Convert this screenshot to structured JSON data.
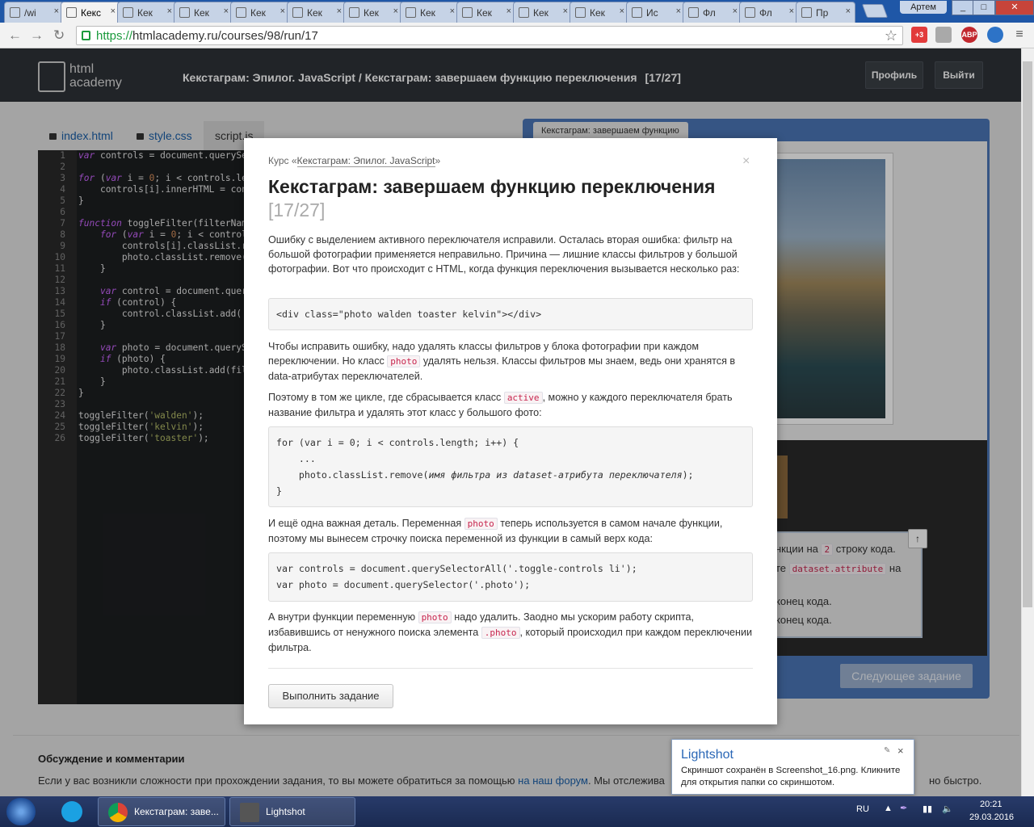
{
  "browser": {
    "tabs": [
      {
        "title": "/wi",
        "icon": "bolt-icon"
      },
      {
        "title": "Кекс",
        "icon": "academy-icon",
        "active": true
      },
      {
        "title": "Кек",
        "icon": "academy-icon"
      },
      {
        "title": "Кек",
        "icon": "academy-icon"
      },
      {
        "title": "Кек",
        "icon": "academy-icon"
      },
      {
        "title": "Кек",
        "icon": "academy-icon"
      },
      {
        "title": "Кек",
        "icon": "academy-icon"
      },
      {
        "title": "Кек",
        "icon": "academy-icon"
      },
      {
        "title": "Кек",
        "icon": "academy-icon"
      },
      {
        "title": "Кек",
        "icon": "academy-icon"
      },
      {
        "title": "Кек",
        "icon": "academy-icon"
      },
      {
        "title": "Ис",
        "icon": "academy-icon"
      },
      {
        "title": "Фл",
        "icon": "academy-icon"
      },
      {
        "title": "Фл",
        "icon": "academy-icon"
      },
      {
        "title": "Пр",
        "icon": "academy-icon"
      }
    ],
    "profile_name": "Артем",
    "url_scheme": "https://",
    "url_rest": "htmlacademy.ru/courses/98/run/17",
    "extension_badge": "+3",
    "abp_label": "ABP"
  },
  "site": {
    "logo_line1": "html",
    "logo_line2": "academy",
    "breadcrumb_course": "Кекстаграм: Эпилог. JavaScript",
    "breadcrumb_sep": " / ",
    "breadcrumb_task": "Кекстаграм: завершаем функцию переключения",
    "breadcrumb_pos": "[17/27]",
    "profile_button": "Профиль",
    "logout_button": "Выйти"
  },
  "editor": {
    "tabs": [
      "index.html",
      "style.css",
      "script.js"
    ],
    "line_numbers": [
      "1",
      "2",
      "3",
      "4",
      "5",
      "6",
      "7",
      "8",
      "9",
      "10",
      "11",
      "12",
      "13",
      "14",
      "15",
      "16",
      "17",
      "18",
      "19",
      "20",
      "21",
      "22",
      "23",
      "24",
      "25",
      "26"
    ],
    "lines": [
      "var controls = document.querySe",
      "",
      "for (var i = 0; i < controls.le",
      "    controls[i].innerHTML = con",
      "}",
      "",
      "function toggleFilter(filterNam",
      "    for (var i = 0; i < control",
      "        controls[i].classList.r",
      "        photo.classList.remove(",
      "    }",
      "",
      "    var control = document.quer",
      "    if (control) {",
      "        control.classList.add('",
      "    }",
      "",
      "    var photo = document.queryS",
      "    if (photo) {",
      "        photo.classList.add(fil",
      "    }",
      "}",
      "",
      "toggleFilter('walden');",
      "toggleFilter('kelvin');",
      "toggleFilter('toaster');"
    ]
  },
  "preview": {
    "tab_title": "Кекстаграм: завершаем функцию",
    "task_line1_pre": "нкции на",
    "task_line1_code": "2",
    "task_line1_post": "строку кода.",
    "task_line2_pre": "те",
    "task_line2_code": "dataset.attribute",
    "task_line2_post": "на",
    "task_line3": "конец кода.",
    "task_line4": "конец кода.",
    "up_button": "↑",
    "next_button": "Следующее задание"
  },
  "discussion": {
    "heading": "Обсуждение и комментарии",
    "text_pre": "Если у вас возникли сложности при прохождении задания, то вы можете обратиться за помощью",
    "link": "на наш форум",
    "text_post": ". Мы отслежива",
    "text_end": "но быстро."
  },
  "modal": {
    "course_prefix": "Курс «",
    "course_link": "Кекстаграм: Эпилог. JavaScript",
    "course_suffix": "»",
    "close": "×",
    "title": "Кекстаграм: завершаем функцию переключения",
    "title_pos": "[17/27]",
    "p1": "Ошибку с выделением активного переключателя исправили. Осталась вторая ошибка: фильтр на большой фотографии применяется неправильно. Причина — лишние классы фильтров у большой фотографии. Вот что происходит с HTML, когда функция переключения вызывается несколько раз:",
    "code1": "<div class=\"photo walden toaster kelvin\"></div>",
    "p2_a": "Чтобы исправить ошибку, надо удалять классы фильтров у блока фотографии при каждом переключении. Но класс",
    "p2_code": "photo",
    "p2_b": "удалять нельзя. Классы фильтров мы знаем, ведь они хранятся в data-атрибутах переключателей.",
    "p3_a": "Поэтому в том же цикле, где сбрасывается класс",
    "p3_code": "active",
    "p3_b": ", можно у каждого переключателя брать название фильтра и удалять этот класс у большого фото:",
    "code2_l1": "for (var i = 0; i < controls.length; i++) {",
    "code2_l2": "    ...",
    "code2_l3a": "    photo.classList.remove(",
    "code2_l3i": "имя фильтра из dataset-атрибута переключателя",
    "code2_l3b": ");",
    "code2_l4": "}",
    "p4_a": "И ещё одна важная деталь. Переменная",
    "p4_code": "photo",
    "p4_b": "теперь используется в самом начале функции, поэтому мы вынесем строчку поиска переменной из функции в самый верх кода:",
    "code3_l1": "var controls = document.querySelectorAll('.toggle-controls li');",
    "code3_l2": "var photo = document.querySelector('.photo');",
    "p5_a": "А внутри функции переменную",
    "p5_code": "photo",
    "p5_b": "надо удалить. Заодно мы ускорим работу скрипта, избавившись от ненужного поиска элемента",
    "p5_code2": ".photo",
    "p5_c": ", который происходил при каждом переключении фильтра.",
    "button": "Выполнить задание"
  },
  "lightshot": {
    "title": "Lightshot",
    "body": "Скриншот сохранён в Screenshot_16.png. Кликните для открытия папки со скриншотом.",
    "close": "×"
  },
  "taskbar": {
    "chrome_title": "Кекстаграм: заве...",
    "lightshot_title": "Lightshot",
    "lang": "RU",
    "time": "20:21",
    "date": "29.03.2016"
  }
}
